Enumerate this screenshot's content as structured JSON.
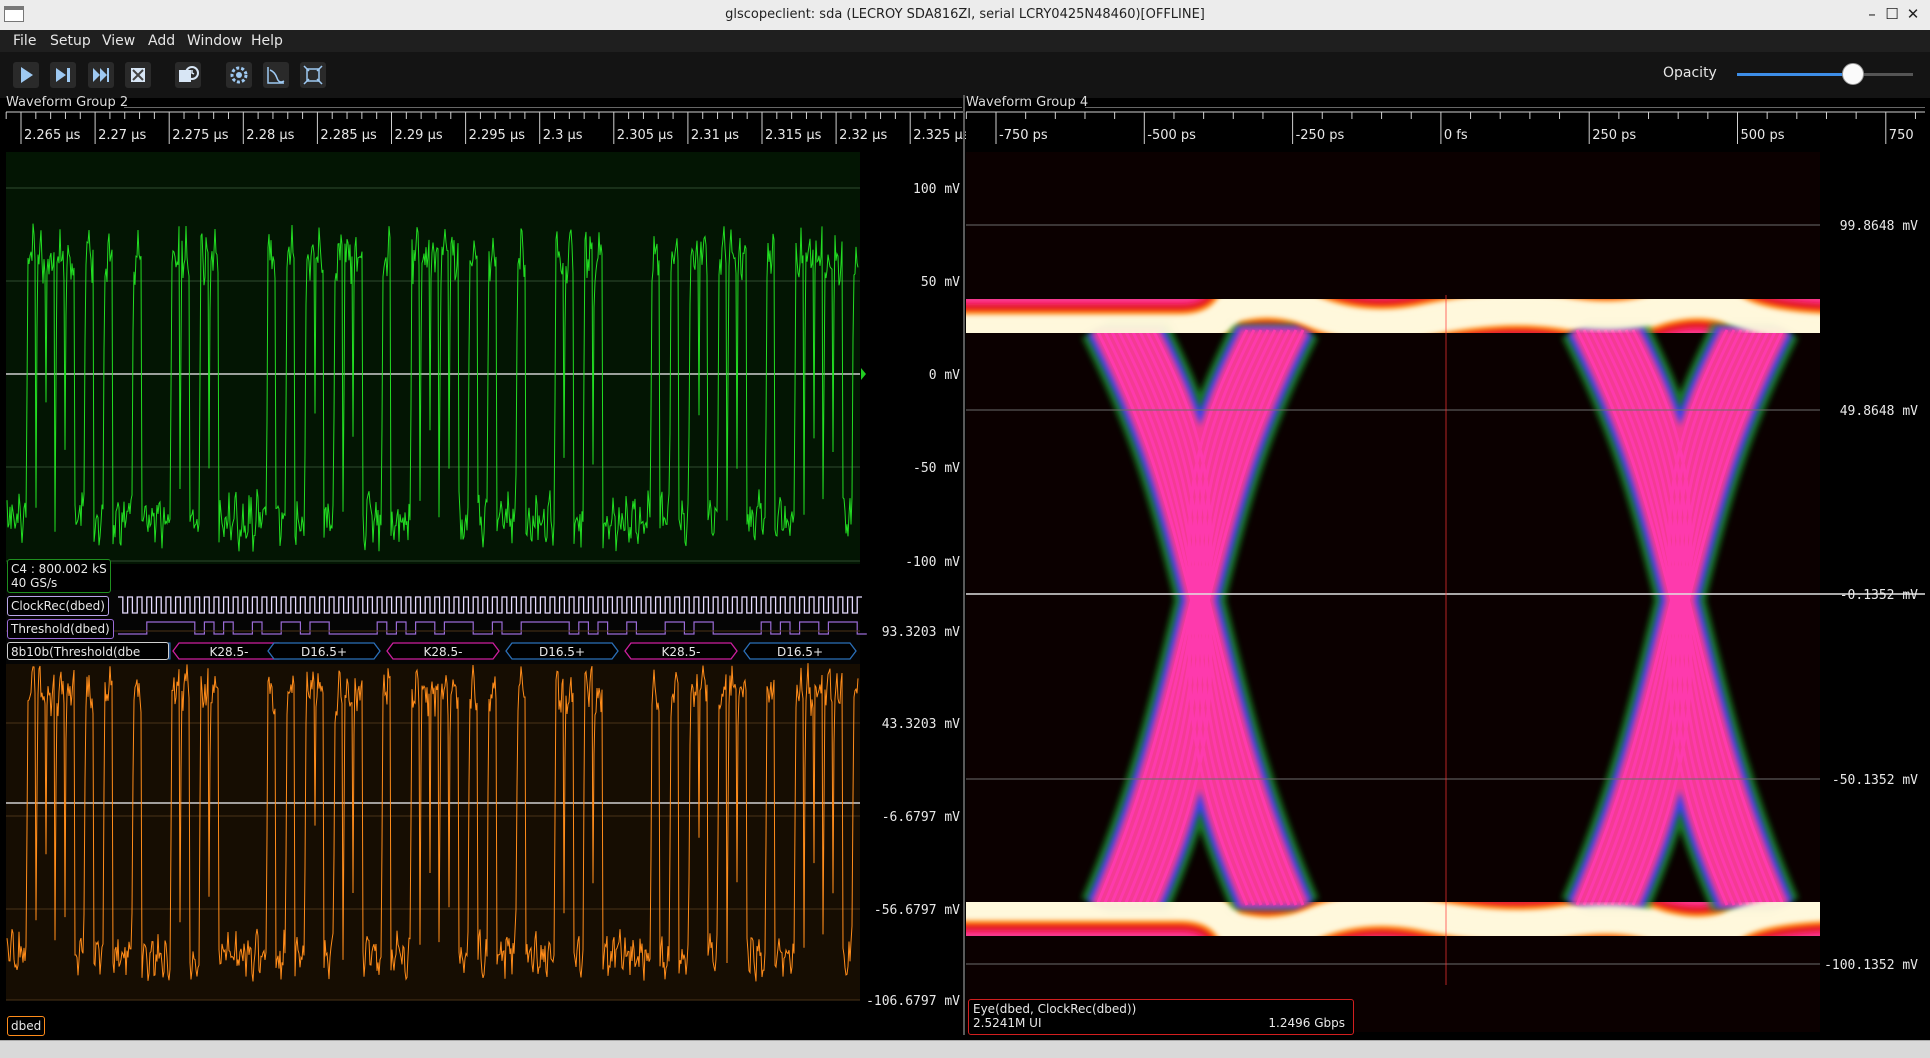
{
  "window": {
    "title": "glscopeclient: sda (LECROY SDA816ZI, serial LCRY0425N48460)[OFFLINE]",
    "minimize": "–",
    "maximize": "☐",
    "close": "✕"
  },
  "menu": [
    "File",
    "Setup",
    "View",
    "Add",
    "Window",
    "Help"
  ],
  "toolbar": {
    "icons": [
      "play-icon",
      "single-step-icon",
      "force-trigger-icon",
      "stop-icon",
      "history-icon",
      "settings-icon",
      "fft-icon",
      "fullscreen-icon"
    ],
    "opacity_label": "Opacity",
    "opacity_value": 0.62
  },
  "group2": {
    "title": "Waveform Group 2",
    "time_ticks": [
      "2.265 µs",
      "2.27 µs",
      "2.275 µs",
      "2.28 µs",
      "2.285 µs",
      "2.29 µs",
      "2.295 µs",
      "2.3 µs",
      "2.305 µs",
      "2.31 µs",
      "2.315 µs",
      "2.32 µs",
      "2.325 µs"
    ],
    "c4": {
      "info_line1": "C4 : 800.002 kS",
      "info_line2": "40 GS/s",
      "y_ticks": [
        "100 mV",
        "50 mV",
        "0 mV",
        "-50 mV",
        "-100 mV"
      ],
      "color": "#22dd22"
    },
    "clockrec_label": "ClockRec(dbed)",
    "threshold_label": "Threshold(dbed)",
    "decode_label": "8b10b(Threshold(dbe",
    "symbols": [
      "K28.5-",
      "D16.5+",
      "K28.5-",
      "D16.5+",
      "K28.5-",
      "D16.5+"
    ],
    "dbed": {
      "label": "dbed",
      "y_ticks": [
        "93.3203 mV",
        "43.3203 mV",
        "-6.6797 mV",
        "-56.6797 mV",
        "-106.6797 mV"
      ],
      "color": "#ff8c1a"
    }
  },
  "group4": {
    "title": "Waveform Group 4",
    "time_ticks": [
      "-750 ps",
      "-500 ps",
      "-250 ps",
      "0 fs",
      "250 ps",
      "500 ps",
      "750"
    ],
    "y_ticks": [
      "99.8648 mV",
      "49.8648 mV",
      "-0.1352 mV",
      "-50.1352 mV",
      "-100.1352 mV"
    ],
    "eye_label": "Eye(dbed, ClockRec(dbed))",
    "ui_count": "2.5241M UI",
    "rate": "1.2496 Gbps"
  },
  "colors": {
    "eye_hot": "#fff8dc",
    "eye_warm": "#ff3b8f",
    "eye_mid": "#3a3cff",
    "eye_cold": "#1ea52e"
  }
}
